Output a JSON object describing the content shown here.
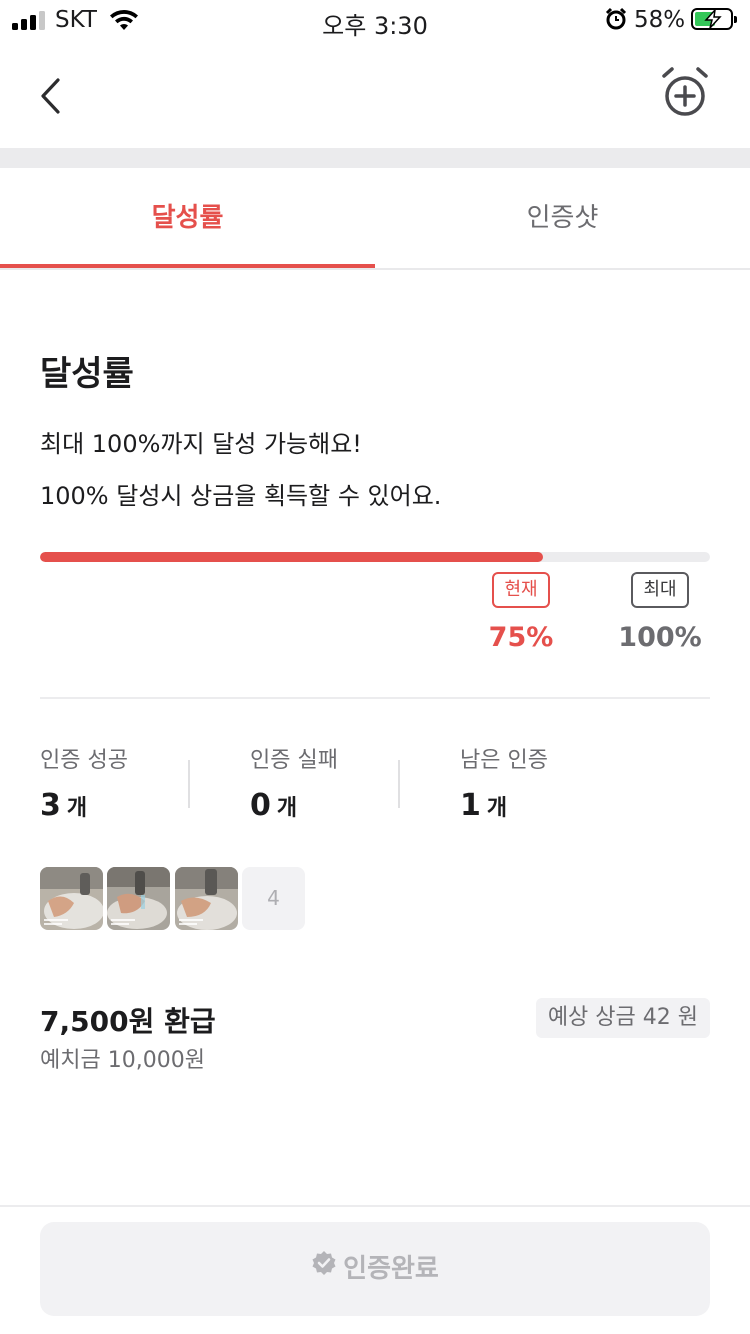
{
  "status_bar": {
    "carrier": "SKT",
    "time": "오후 3:30",
    "battery_percent": "58%",
    "battery_level": 0.58,
    "signal_bars": 3
  },
  "nav": {
    "back_icon": "chevron-left-icon",
    "action_icon": "alarm-add-icon"
  },
  "tabs": [
    {
      "label": "달성률",
      "active": true
    },
    {
      "label": "인증샷",
      "active": false
    }
  ],
  "achievement": {
    "title": "달성률",
    "description_line1": "최대 100%까지 달성 가능해요!",
    "description_line2": "100% 달성시 상금을 획득할 수 있어요.",
    "progress_fraction": 0.75,
    "current_badge": "현재",
    "current_value": "75%",
    "max_badge": "최대",
    "max_value": "100%"
  },
  "stats": [
    {
      "label": "인증 성공",
      "value": "3",
      "unit": "개"
    },
    {
      "label": "인증 실패",
      "value": "0",
      "unit": "개"
    },
    {
      "label": "남은 인증",
      "value": "1",
      "unit": "개"
    }
  ],
  "thumbnails": {
    "remaining_slot_label": "4"
  },
  "refund": {
    "amount_text": "7,500원 환급",
    "deposit_text": "예치금 10,000원",
    "expected_prize_text": "예상 상금 42 원"
  },
  "footer": {
    "button_label": "인증완료"
  },
  "colors": {
    "accent": "#e5504c",
    "muted_text": "#6c6c70",
    "disabled_bg": "#f2f2f4"
  }
}
